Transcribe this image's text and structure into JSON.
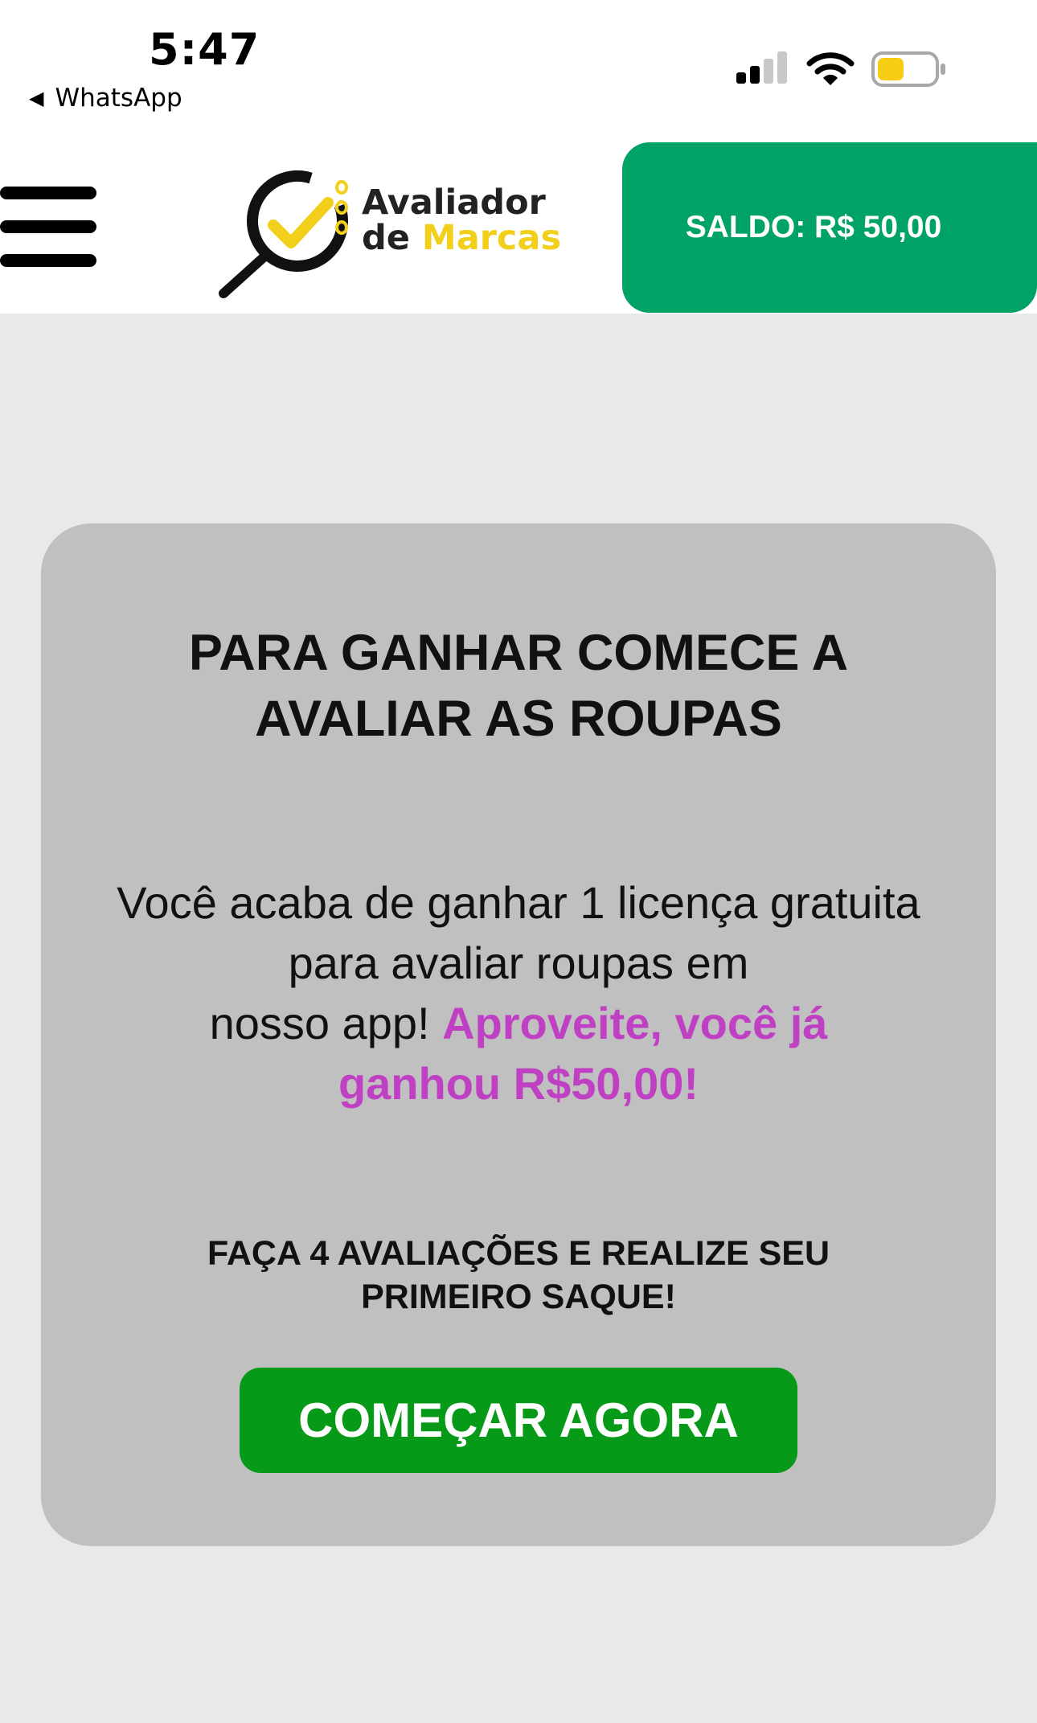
{
  "status_bar": {
    "time": "5:47",
    "back_app": "WhatsApp",
    "icons": [
      "back-triangle-icon",
      "cellular-signal-icon",
      "wifi-icon",
      "battery-icon"
    ]
  },
  "header": {
    "menu_icon": "hamburger-menu-icon",
    "logo": {
      "line1": "Avaliador",
      "line2_prefix": "de ",
      "line2_accent": "Marcas"
    },
    "balance_label": "SALDO: R$ 50,00"
  },
  "card": {
    "title": "PARA GANHAR COMECE A AVALIAR AS ROUPAS",
    "body_text": "Você acaba de ganhar 1 licença gratuita para avaliar roupas em nosso app!",
    "body_highlight": "Aproveite, você já ganhou R$50,00!",
    "cta_text": "FAÇA 4 AVALIAÇÕES E REALIZE SEU PRIMEIRO SAQUE!",
    "start_button": "COMEÇAR AGORA"
  },
  "colors": {
    "balance_button": "#01a266",
    "start_button": "#079a18",
    "highlight": "#c040c4",
    "logo_accent": "#f2cf1a",
    "card_bg": "#c0c0c0",
    "page_bg": "#e9e9e9"
  }
}
